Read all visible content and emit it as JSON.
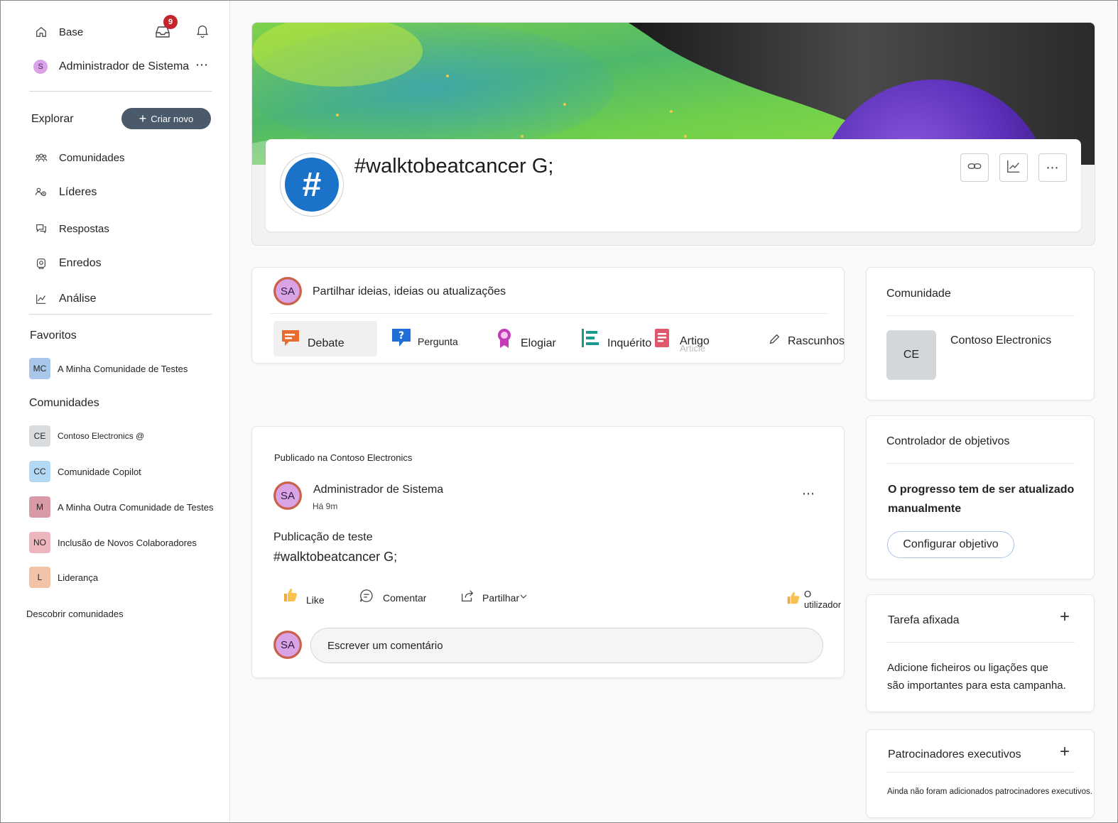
{
  "sidebar": {
    "home_label": "Base",
    "inbox_badge": "9",
    "user_initial": "S",
    "user_name": "Administrador de Sistema",
    "more_label": "⋯",
    "explore_label": "Explorar",
    "create_label": "Criar novo",
    "nav": [
      {
        "label": "Comunidades",
        "icon": "communities-icon"
      },
      {
        "label": "Líderes",
        "icon": "leaders-icon"
      },
      {
        "label": "Respostas",
        "icon": "answers-icon"
      },
      {
        "label": "Enredos",
        "icon": "storylines-icon"
      },
      {
        "label": "Análise",
        "icon": "analytics-icon"
      }
    ],
    "favorites_label": "Favoritos",
    "favorites": [
      {
        "initials": "MC",
        "label": "A Minha Comunidade de Testes",
        "color": "#a9c7ea"
      }
    ],
    "communities_label": "Comunidades",
    "communities": [
      {
        "initials": "CE",
        "label": "Contoso Electronics @",
        "color": "#d9dcdf"
      },
      {
        "initials": "CC",
        "label": "Comunidade Copilot",
        "color": "#b3d9f5"
      },
      {
        "initials": "M",
        "label": "A Minha Outra Comunidade de Testes",
        "color": "#d99aa7"
      },
      {
        "initials": "NO",
        "label": "Inclusão de Novos Colaboradores",
        "color": "#eeb6bd"
      },
      {
        "initials": "L",
        "label": "Liderança",
        "color": "#f3c3a8"
      }
    ],
    "discover_label": "Descobrir comunidades"
  },
  "campaign": {
    "title": "#walktobeatcancer G;",
    "hash_symbol": "#"
  },
  "composer": {
    "avatar": "SA",
    "placeholder": "Partilhar ideias, ideias ou atualizações",
    "types": {
      "debate": "Debate",
      "question": "Pergunta",
      "praise": "Elogiar",
      "poll": "Inquérito",
      "article": "Artigo",
      "article_ghost": "Article",
      "drafts": "Rascunhos"
    }
  },
  "post": {
    "posted_in": "Publicado na Contoso Electronics",
    "author_avatar": "SA",
    "author": "Administrador de Sistema",
    "time": "Há 9m",
    "more": "⋯",
    "body_line1": "Publicação de teste",
    "body_line2": "#walktobeatcancer G;",
    "like_label": "Like",
    "comment_label": "Comentar",
    "share_label": "Partilhar",
    "reactor_label": "O utilizador",
    "comment_avatar": "SA",
    "comment_placeholder": "Escrever um comentário"
  },
  "right": {
    "community": {
      "title": "Comunidade",
      "initials": "CE",
      "name": "Contoso Electronics"
    },
    "goals": {
      "title": "Controlador de objetivos",
      "message_line1": "O progresso tem de ser atualizado",
      "message_line2": "manualmente",
      "button": "Configurar objetivo"
    },
    "pinned": {
      "title": "Tarefa afixada",
      "add": "+",
      "text_line1": "Adicione ficheiros ou ligações que",
      "text_line2": "são importantes para esta campanha."
    },
    "sponsors": {
      "title": "Patrocinadores executivos",
      "add": "+",
      "text": "Ainda não foram adicionados patrocinadores executivos."
    }
  },
  "colors": {
    "accent": "#1a73c8",
    "badge": "#c4262e",
    "create_button": "#4b5a6b"
  }
}
